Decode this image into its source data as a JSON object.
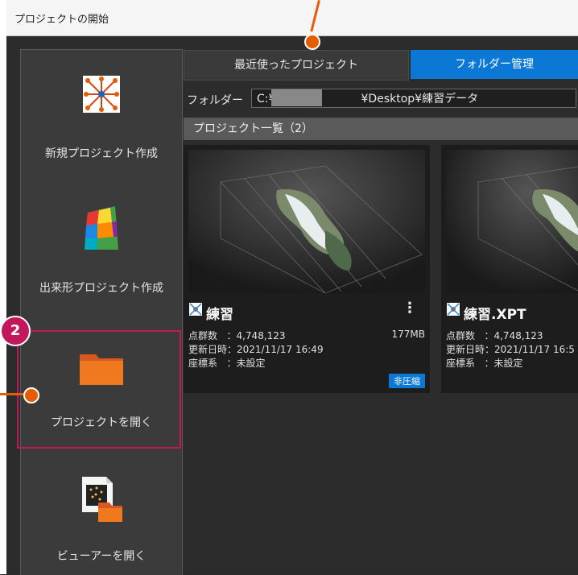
{
  "window": {
    "title": "プロジェクトの開始"
  },
  "sidebar": {
    "items": [
      {
        "label": "新規プロジェクト作成",
        "icon": "new-project-icon"
      },
      {
        "label": "出来形プロジェクト作成",
        "icon": "as-built-project-icon"
      },
      {
        "label": "プロジェクトを開く",
        "icon": "folder-icon"
      },
      {
        "label": "ビューアーを開く",
        "icon": "viewer-icon"
      }
    ]
  },
  "tabs": {
    "recent": "最近使ったプロジェクト",
    "folder": "フォルダー管理"
  },
  "folder": {
    "label": "フォルダー",
    "path_prefix": "C:¥Users¥",
    "path_suffix": "¥Desktop¥練習データ"
  },
  "list": {
    "header": "プロジェクト一覧（2）"
  },
  "projects": [
    {
      "name": "練習",
      "points_label": "点群数",
      "points": "：4,748,123",
      "updated_label": "更新日時",
      "updated": "：2021/11/17 16:49",
      "crs_label": "座標系",
      "crs": "：未設定",
      "size": "177MB",
      "flag": "非圧縮"
    },
    {
      "name": "練習.XPT",
      "points_label": "点群数",
      "points": "：4,748,123",
      "updated_label": "更新日時",
      "updated": "：2021/11/17 16:5",
      "crs_label": "座標系",
      "crs": "：未設定"
    }
  ],
  "annotation": {
    "step": "2"
  },
  "colors": {
    "accent": "#0a78d4",
    "highlight": "#c2185b",
    "callout": "#e65c00"
  }
}
